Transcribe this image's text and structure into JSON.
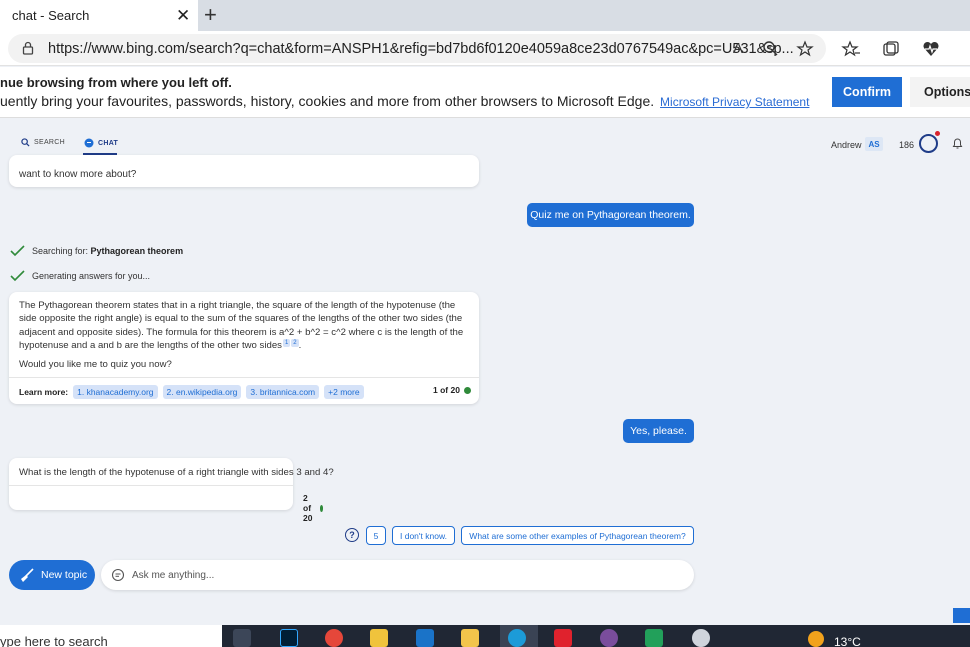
{
  "browser": {
    "tab_title": "chat - Search",
    "tab_close": "✕",
    "new_tab": "+",
    "url": "https://www.bing.com/search?q=chat&form=ANSPH1&refig=bd7bd6f0120e4059a8ce23d0767549ac&pc=U531&sp..."
  },
  "banner": {
    "title": "nue browsing from where you left off.",
    "text": "uently bring your favourites, passwords, history, cookies and more from other browsers to Microsoft Edge.",
    "link": "Microsoft Privacy Statement",
    "confirm": "Confirm",
    "options": "Options"
  },
  "header": {
    "search_tab": "SEARCH",
    "chat_tab": "CHAT",
    "user_name": "Andrew",
    "user_initials": "AS",
    "points": "186"
  },
  "chat": {
    "prev_snippet": "want to know more about?",
    "user_msg_1": "Quiz me on Pythagorean theorem.",
    "status_search_label": "Searching for:",
    "status_search_term": "Pythagorean theorem",
    "status_generating": "Generating answers for you...",
    "answer_text": "The Pythagorean theorem states that in a right triangle, the square of the length of the hypotenuse (the side opposite the right angle) is equal to the sum of the squares of the lengths of the other two sides (the adjacent and opposite sides). The formula for this theorem is a^2 + b^2 = c^2 where c is the length of the hypotenuse and a and b are the lengths of the other two sides",
    "ref_1": "1",
    "ref_2": "2",
    "answer_question": "Would you like me to quiz you now?",
    "learn_more_label": "Learn more:",
    "sources": [
      "1. khanacademy.org",
      "2. en.wikipedia.org",
      "3. britannica.com",
      "+2 more"
    ],
    "answer_counter": "1 of 20",
    "user_msg_2": "Yes, please.",
    "quiz_question": "What is the length of the hypotenuse of a right triangle with sides 3 and 4?",
    "quiz_counter": "2 of 20"
  },
  "suggestions": {
    "help": "?",
    "chips": [
      "5",
      "I don't know.",
      "What are some other examples of Pythagorean theorem?"
    ]
  },
  "input": {
    "new_topic": "New topic",
    "placeholder": "Ask me anything..."
  },
  "taskbar": {
    "search_text": "ype here to search",
    "temperature": "13°C"
  },
  "colors": {
    "accent": "#1f6ed4",
    "status_green": "#2f8a3a"
  }
}
